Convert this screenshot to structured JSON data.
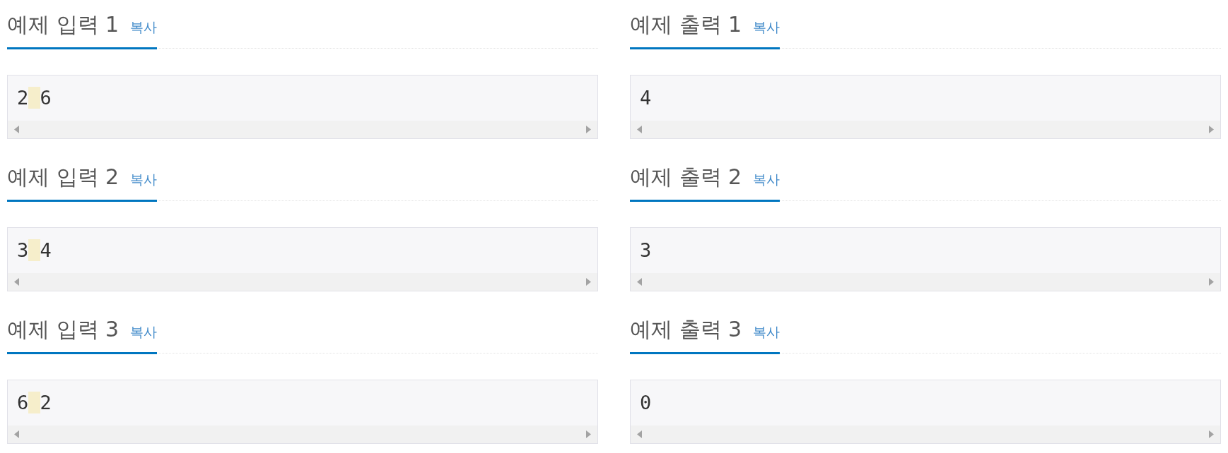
{
  "samples": [
    {
      "input": {
        "heading": "예제 입력 1",
        "copy": "복사",
        "text": "2 6"
      },
      "output": {
        "heading": "예제 출력 1",
        "copy": "복사",
        "text": "4"
      }
    },
    {
      "input": {
        "heading": "예제 입력 2",
        "copy": "복사",
        "text": "3 4"
      },
      "output": {
        "heading": "예제 출력 2",
        "copy": "복사",
        "text": "3"
      }
    },
    {
      "input": {
        "heading": "예제 입력 3",
        "copy": "복사",
        "text": "6 2"
      },
      "output": {
        "heading": "예제 출력 3",
        "copy": "복사",
        "text": "0"
      }
    }
  ]
}
